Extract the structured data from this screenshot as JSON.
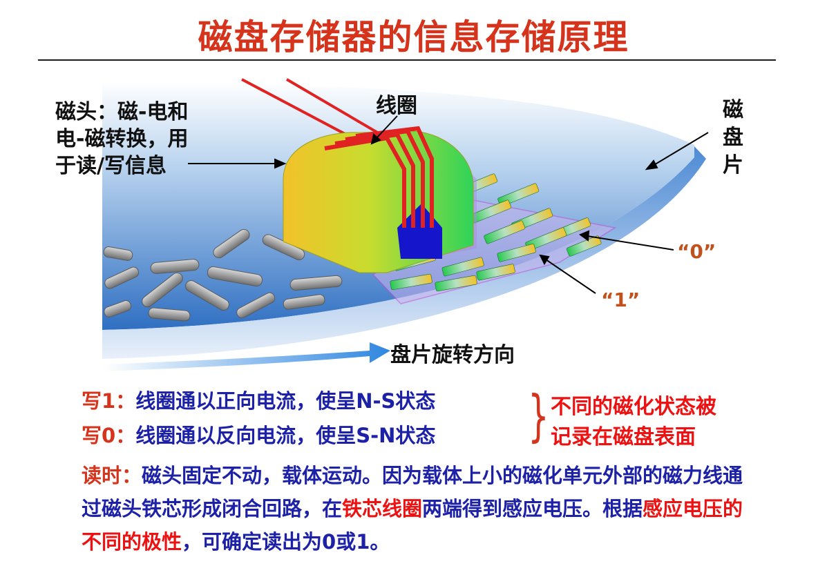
{
  "title": "磁盘存储器的信息存储原理",
  "labels": {
    "head": [
      "磁头：磁-电和",
      "电-磁转换，用",
      "于读/写信息"
    ],
    "coil": "线圈",
    "disk": [
      "磁",
      "盘",
      "片"
    ],
    "rotation": "盘片旋转方向",
    "zero": "“0”",
    "one": "“1”"
  },
  "write1": {
    "prefix": "写1：",
    "text": "线圈通以正向电流，使呈N-S状态"
  },
  "write0": {
    "prefix": "写0：",
    "text": "线圈通以反向电流，使呈S-N状态"
  },
  "brace": "}",
  "result": [
    "不同的磁化状态被",
    "记录在磁盘表面"
  ],
  "read": {
    "prefix": "读时：",
    "part1": "磁头固定不动，载体运动。因为载体上小的磁化单元外部的磁力线通过磁头铁芯形成闭合回路，在",
    "hl1": "铁芯线圈",
    "part2": "两端得到感应电压。根据",
    "hl2": "感应电压的不同的极性",
    "part3": "，可确定读出为0或1。"
  },
  "icons": [
    "write-head-icon",
    "magnetic-particle-icon",
    "rotation-arrow-icon"
  ],
  "colors": {
    "title": "#d5331b",
    "body": "#1c21a8",
    "highlight": "#ee1111",
    "disk": "#3b7cc8"
  }
}
